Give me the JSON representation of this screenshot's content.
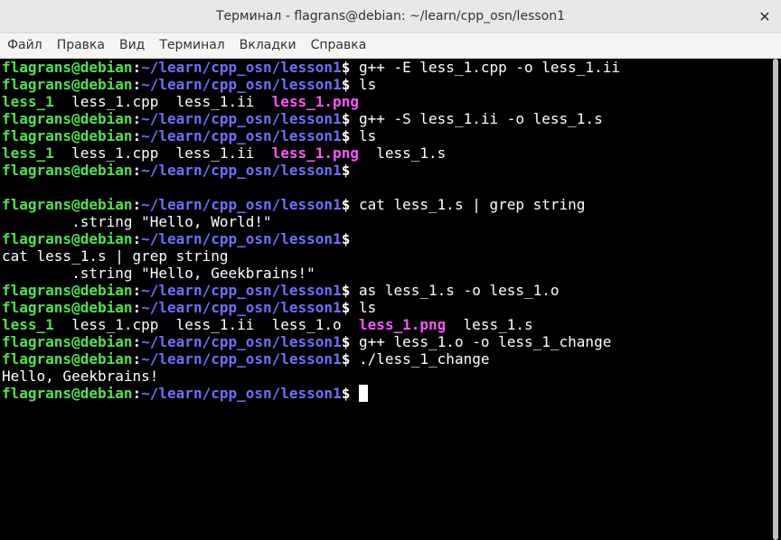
{
  "window": {
    "title": "Терминал - flagrans@debian: ~/learn/cpp_osn/lesson1"
  },
  "menu": [
    "Файл",
    "Правка",
    "Вид",
    "Терминал",
    "Вкладки",
    "Справка"
  ],
  "prompt": {
    "user": "flagrans@debian",
    "sep": ":",
    "path": "~/learn/cpp_osn/lesson1",
    "dollar": "$"
  },
  "lines": [
    {
      "p": true,
      "cmd": " g++ -E less_1.cpp -o less_1.ii"
    },
    {
      "p": true,
      "cmd": " ls"
    },
    {
      "segs": [
        {
          "t": "less_1",
          "c": "exec"
        },
        {
          "t": "  less_1.cpp  less_1.ii  "
        },
        {
          "t": "less_1.png",
          "c": "img"
        }
      ]
    },
    {
      "p": true,
      "cmd": " g++ -S less_1.ii -o less_1.s"
    },
    {
      "p": true,
      "cmd": " ls"
    },
    {
      "segs": [
        {
          "t": "less_1",
          "c": "exec"
        },
        {
          "t": "  less_1.cpp  less_1.ii  "
        },
        {
          "t": "less_1.png",
          "c": "img"
        },
        {
          "t": "  less_1.s"
        }
      ]
    },
    {
      "p": true,
      "cmd": ""
    },
    {
      "segs": [
        {
          "t": ""
        }
      ]
    },
    {
      "p": true,
      "cmd": " cat less_1.s | grep string"
    },
    {
      "segs": [
        {
          "t": "        .string \"Hello, World!\""
        }
      ]
    },
    {
      "p": true,
      "cmd": ""
    },
    {
      "segs": [
        {
          "t": "cat less_1.s | grep string"
        }
      ]
    },
    {
      "segs": [
        {
          "t": "        .string \"Hello, Geekbrains!\""
        }
      ]
    },
    {
      "p": true,
      "cmd": " as less_1.s -o less_1.o"
    },
    {
      "p": true,
      "cmd": " ls"
    },
    {
      "segs": [
        {
          "t": "less_1",
          "c": "exec"
        },
        {
          "t": "  less_1.cpp  less_1.ii  less_1.o  "
        },
        {
          "t": "less_1.png",
          "c": "img"
        },
        {
          "t": "  less_1.s"
        }
      ]
    },
    {
      "p": true,
      "cmd": " g++ less_1.o -o less_1_change"
    },
    {
      "p": true,
      "cmd": " ./less_1_change"
    },
    {
      "segs": [
        {
          "t": "Hello, Geekbrains!"
        }
      ]
    },
    {
      "p": true,
      "cmd": " ",
      "cursor": true
    }
  ],
  "icons": {
    "close": "close-icon"
  }
}
